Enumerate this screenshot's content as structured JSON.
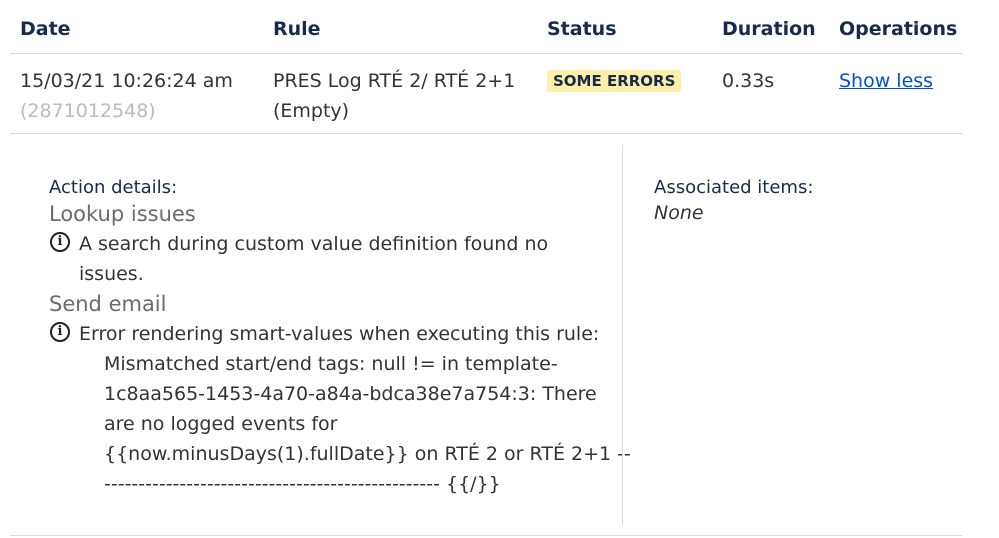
{
  "table": {
    "headers": {
      "date": "Date",
      "rule": "Rule",
      "status": "Status",
      "duration": "Duration",
      "operations": "Operations"
    },
    "row": {
      "date": "15/03/21 10:26:24 am",
      "id": "(2871012548)",
      "rule_line1": "PRES Log RTÉ 2/ RTÉ 2+1",
      "rule_line2": "(Empty)",
      "status": "SOME ERRORS",
      "duration": "0.33s",
      "operation": "Show less"
    }
  },
  "details": {
    "action_title": "Action details:",
    "lookup": {
      "title": "Lookup issues",
      "message_line1": "A search during custom value definition found no",
      "message_line2": "issues."
    },
    "email": {
      "title": "Send email",
      "message_line1": "Error rendering smart-values when executing this rule:",
      "message_line2": "Mismatched start/end tags: null != in template-",
      "message_line3": "1c8aa565-1453-4a70-a84a-bdca38e7a754:3: There",
      "message_line4": "are no logged events for",
      "message_line5": "{{now.minusDays(1).fullDate}} on RTÉ 2 or RTÉ 2+1 --",
      "message_line6": "------------------------------------------------- {{/}}"
    },
    "associated_title": "Associated items:",
    "associated_value": "None"
  },
  "colors": {
    "badge_bg": "#ffefa8",
    "link": "#0052cc",
    "muted": "#bbbbbb"
  },
  "icons": {
    "info": "info-circle-icon"
  }
}
